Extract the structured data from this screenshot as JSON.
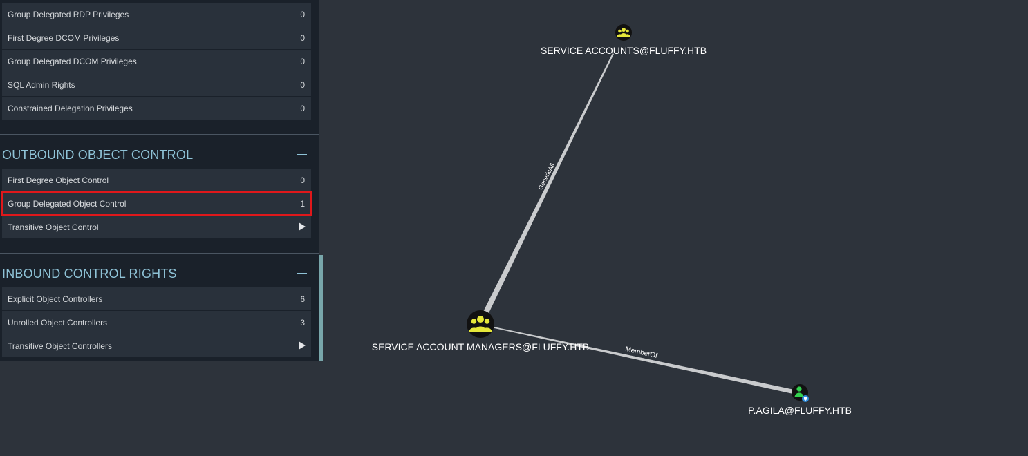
{
  "panel": {
    "top_rows": [
      {
        "label": "Group Delegated RDP Privileges",
        "count": "0"
      },
      {
        "label": "First Degree DCOM Privileges",
        "count": "0"
      },
      {
        "label": "Group Delegated DCOM Privileges",
        "count": "0"
      },
      {
        "label": "SQL Admin Rights",
        "count": "0"
      },
      {
        "label": "Constrained Delegation Privileges",
        "count": "0"
      }
    ],
    "outbound": {
      "title": "OUTBOUND OBJECT CONTROL",
      "rows": [
        {
          "label": "First Degree Object Control",
          "count": "0"
        },
        {
          "label": "Group Delegated Object Control",
          "count": "1"
        },
        {
          "label": "Transitive Object Control",
          "icon": "play-arrow-icon"
        }
      ]
    },
    "inbound": {
      "title": "INBOUND CONTROL RIGHTS",
      "rows": [
        {
          "label": "Explicit Object Controllers",
          "count": "6"
        },
        {
          "label": "Unrolled Object Controllers",
          "count": "3"
        },
        {
          "label": "Transitive Object Controllers",
          "icon": "play-arrow-icon"
        }
      ]
    },
    "highlight_color": "#e0181b"
  },
  "graph": {
    "nodes": [
      {
        "label": "SERVICE ACCOUNTS@FLUFFY.HTB",
        "type": "group",
        "icon": "group-icon"
      },
      {
        "label": "SERVICE ACCOUNT MANAGERS@FLUFFY.HTB",
        "type": "group",
        "icon": "group-icon"
      },
      {
        "label": "P.AGILA@FLUFFY.HTB",
        "type": "user",
        "icon": "user-icon"
      }
    ],
    "edges": [
      {
        "label": "GenericAll",
        "from": "SERVICE ACCOUNT MANAGERS@FLUFFY.HTB",
        "to": "SERVICE ACCOUNTS@FLUFFY.HTB"
      },
      {
        "label": "MemberOf",
        "from": "P.AGILA@FLUFFY.HTB",
        "to": "SERVICE ACCOUNT MANAGERS@FLUFFY.HTB"
      }
    ],
    "colors": {
      "group_icon": "#e6e83a",
      "user_icon": "#33d14f",
      "node_bg": "#111111",
      "edge": "#c9cbcd",
      "badge": "#2f8fe0"
    }
  }
}
